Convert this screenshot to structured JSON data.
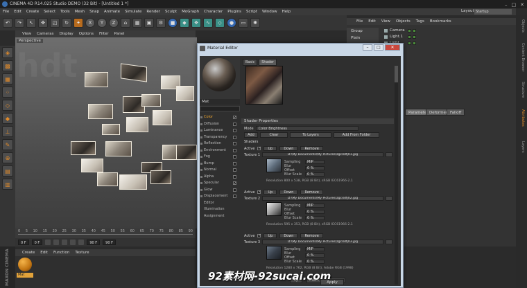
{
  "app": {
    "title": "CINEMA 4D R14.025 Studio DEMO (32 Bit) - [Untitled 1 *]",
    "window_controls": [
      "–",
      "□",
      "✕"
    ]
  },
  "menubar": [
    "File",
    "Edit",
    "Create",
    "Select",
    "Tools",
    "Mesh",
    "Snap",
    "Animate",
    "Simulate",
    "Render",
    "Sculpt",
    "MoGraph",
    "Character",
    "Plugins",
    "Script",
    "Window",
    "Help"
  ],
  "layout": {
    "label": "Layout:",
    "value": "Startup"
  },
  "viewport": {
    "menu": [
      "View",
      "Cameras",
      "Display",
      "Options",
      "Filter",
      "Panel"
    ],
    "tag": "Perspective"
  },
  "timeline": {
    "ticks": [
      "0",
      "5",
      "10",
      "15",
      "20",
      "25",
      "30",
      "35",
      "40",
      "45",
      "50",
      "55",
      "60",
      "65",
      "70",
      "75",
      "80",
      "85",
      "90"
    ],
    "start": "0 F",
    "current": "0 F",
    "end": "90 F",
    "end2": "90 F"
  },
  "material_manager": {
    "menu": [
      "Create",
      "Edit",
      "Function",
      "Texture"
    ],
    "material_name": "Mat",
    "brand": "MAXON CINEMA 4D"
  },
  "objects": {
    "menu": [
      "File",
      "Edit",
      "View",
      "Objects",
      "Tags",
      "Bookmarks"
    ],
    "side": [
      "Group",
      "Plain"
    ],
    "items": [
      "Camera",
      "Light.1",
      "Light"
    ]
  },
  "attributes": {
    "tabs": [
      "Parameter",
      "Deformer",
      "Falloff"
    ]
  },
  "right_strip": [
    "Objects",
    "Content Browser",
    "Structure",
    "Attributes",
    "Layers"
  ],
  "material_editor": {
    "title": "Material Editor",
    "window_buttons": [
      "–",
      "□",
      "✕"
    ],
    "mat_name": "Mat",
    "channels": [
      {
        "label": "Color",
        "checked": true,
        "selected": true
      },
      {
        "label": "Diffusion",
        "checked": false
      },
      {
        "label": "Luminance",
        "checked": false
      },
      {
        "label": "Transparency",
        "checked": false
      },
      {
        "label": "Reflection",
        "checked": false
      },
      {
        "label": "Environment",
        "checked": false
      },
      {
        "label": "Fog",
        "checked": false
      },
      {
        "label": "Bump",
        "checked": false
      },
      {
        "label": "Normal",
        "checked": false
      },
      {
        "label": "Alpha",
        "checked": false
      },
      {
        "label": "Specular",
        "checked": true
      },
      {
        "label": "Glow",
        "checked": false
      },
      {
        "label": "Displacement",
        "checked": false
      },
      {
        "label": "Editor",
        "checked": null
      },
      {
        "label": "Illumination",
        "checked": null
      },
      {
        "label": "Assignment",
        "checked": null
      }
    ],
    "tabs": [
      "Basic",
      "Shader"
    ],
    "section": "Shader Properties",
    "mode_label": "Mode",
    "mode_value": "Color Brightness",
    "buttons": {
      "add": "Add",
      "clear": "Clear",
      "to_layers": "To Layers",
      "add_folder": "Add From Folder"
    },
    "shaders_label": "Shaders",
    "active_label": "Active",
    "up": "Up",
    "down": "Down",
    "remove": "Remove",
    "sampling_label": "Sampling",
    "sampling_value": "MIP",
    "blur_offset_label": "Blur Offset",
    "blur_scale_label": "Blur Scale",
    "blur_value": "0 %",
    "textures": [
      {
        "label": "Texture 1",
        "path": "D:\\My Documents\\My Pictures\\zgc4dfj01.jpg",
        "res": "Resolution 800 x 538, RGB (8 Bit), sRGB IEC61966-2.1"
      },
      {
        "label": "Texture 2",
        "path": "D:\\My Documents\\My Pictures\\zgc4dfj02.jpg",
        "res": "Resolution 595 x 353, RGB (8 Bit), sRGB IEC61966-2.1"
      },
      {
        "label": "Texture 3",
        "path": "D:\\My Documents\\My Pictures\\zgc4dfj03.jpg",
        "res": "Resolution 1280 x 762, RGB (8 Bit), Adobe RGB (1998)"
      }
    ]
  },
  "apply_label": "Apply",
  "watermark": "92素材网-92sucai.com"
}
